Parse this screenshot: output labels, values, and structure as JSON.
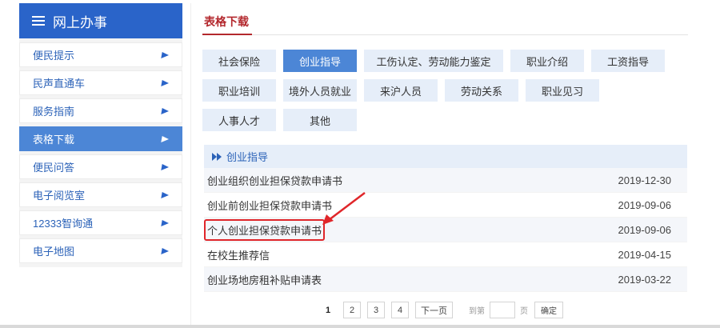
{
  "sidebar": {
    "title": "网上办事",
    "items": [
      {
        "label": "便民提示"
      },
      {
        "label": "民声直通车"
      },
      {
        "label": "服务指南"
      },
      {
        "label": "表格下载"
      },
      {
        "label": "便民问答"
      },
      {
        "label": "电子阅览室"
      },
      {
        "label": "12333智询通"
      },
      {
        "label": "电子地图"
      }
    ],
    "active_index": 3
  },
  "main": {
    "title": "表格下载",
    "categories_row1": [
      "社会保险",
      "创业指导",
      "工伤认定、劳动能力鉴定",
      "职业介绍",
      "工资指导"
    ],
    "categories_row2": [
      "职业培训",
      "境外人员就业",
      "来沪人员",
      "劳动关系",
      "职业见习"
    ],
    "categories_row3": [
      "人事人才",
      "其他"
    ],
    "active_category": "创业指导",
    "list_header": "创业指导",
    "rows": [
      {
        "name": "创业组织创业担保贷款申请书",
        "date": "2019-12-30"
      },
      {
        "name": "创业前创业担保贷款申请书",
        "date": "2019-09-06"
      },
      {
        "name": "个人创业担保贷款申请书",
        "date": "2019-09-06"
      },
      {
        "name": "在校生推荐信",
        "date": "2019-04-15"
      },
      {
        "name": "创业场地房租补贴申请表",
        "date": "2019-03-22"
      }
    ],
    "highlighted_row": 2
  },
  "pager": {
    "pages": [
      "1",
      "2",
      "3",
      "4"
    ],
    "current": "1",
    "next": "下一页",
    "goto_label": "到第",
    "unit": "页",
    "confirm": "确定"
  },
  "colors": {
    "accent_blue": "#2a64c9",
    "active_blue": "#4c86d6",
    "title_red": "#b3282d",
    "highlight_red": "#e0262a"
  }
}
